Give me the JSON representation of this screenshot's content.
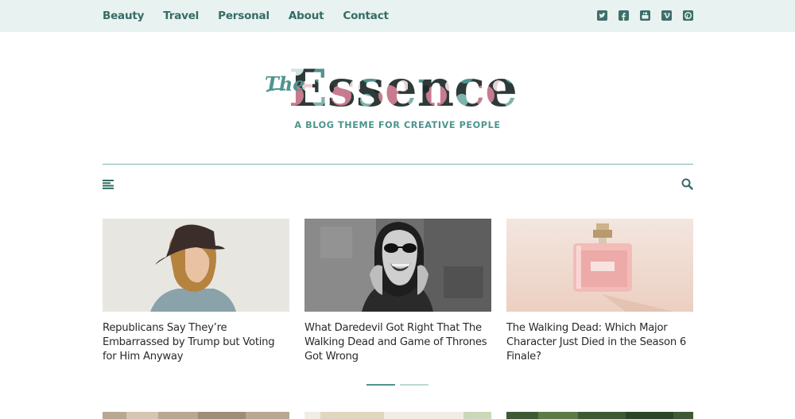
{
  "nav": {
    "items": [
      "Beauty",
      "Travel",
      "Personal",
      "About",
      "Contact"
    ]
  },
  "social": [
    "twitter-icon",
    "facebook-icon",
    "youtube-icon",
    "vimeo-icon",
    "pinterest-icon"
  ],
  "brand": {
    "logo_script": "The",
    "logo_word": "Essence",
    "tagline": "A BLOG THEME FOR CREATIVE PEOPLE",
    "accent_color": "#4f948e",
    "nav_color": "#356b66",
    "topbar_bg": "#e8f2f0"
  },
  "posts": [
    {
      "title": "Republicans Say They’re Embarrassed by Trump but Voting for Him Anyway"
    },
    {
      "title": "What Daredevil Got Right That The Walking Dead and Game of Thrones Got Wrong"
    },
    {
      "title": "The Walking Dead: Which Major Character Just Died in the Season 6 Finale?"
    }
  ],
  "pager": {
    "pages": 2,
    "active": 1
  }
}
